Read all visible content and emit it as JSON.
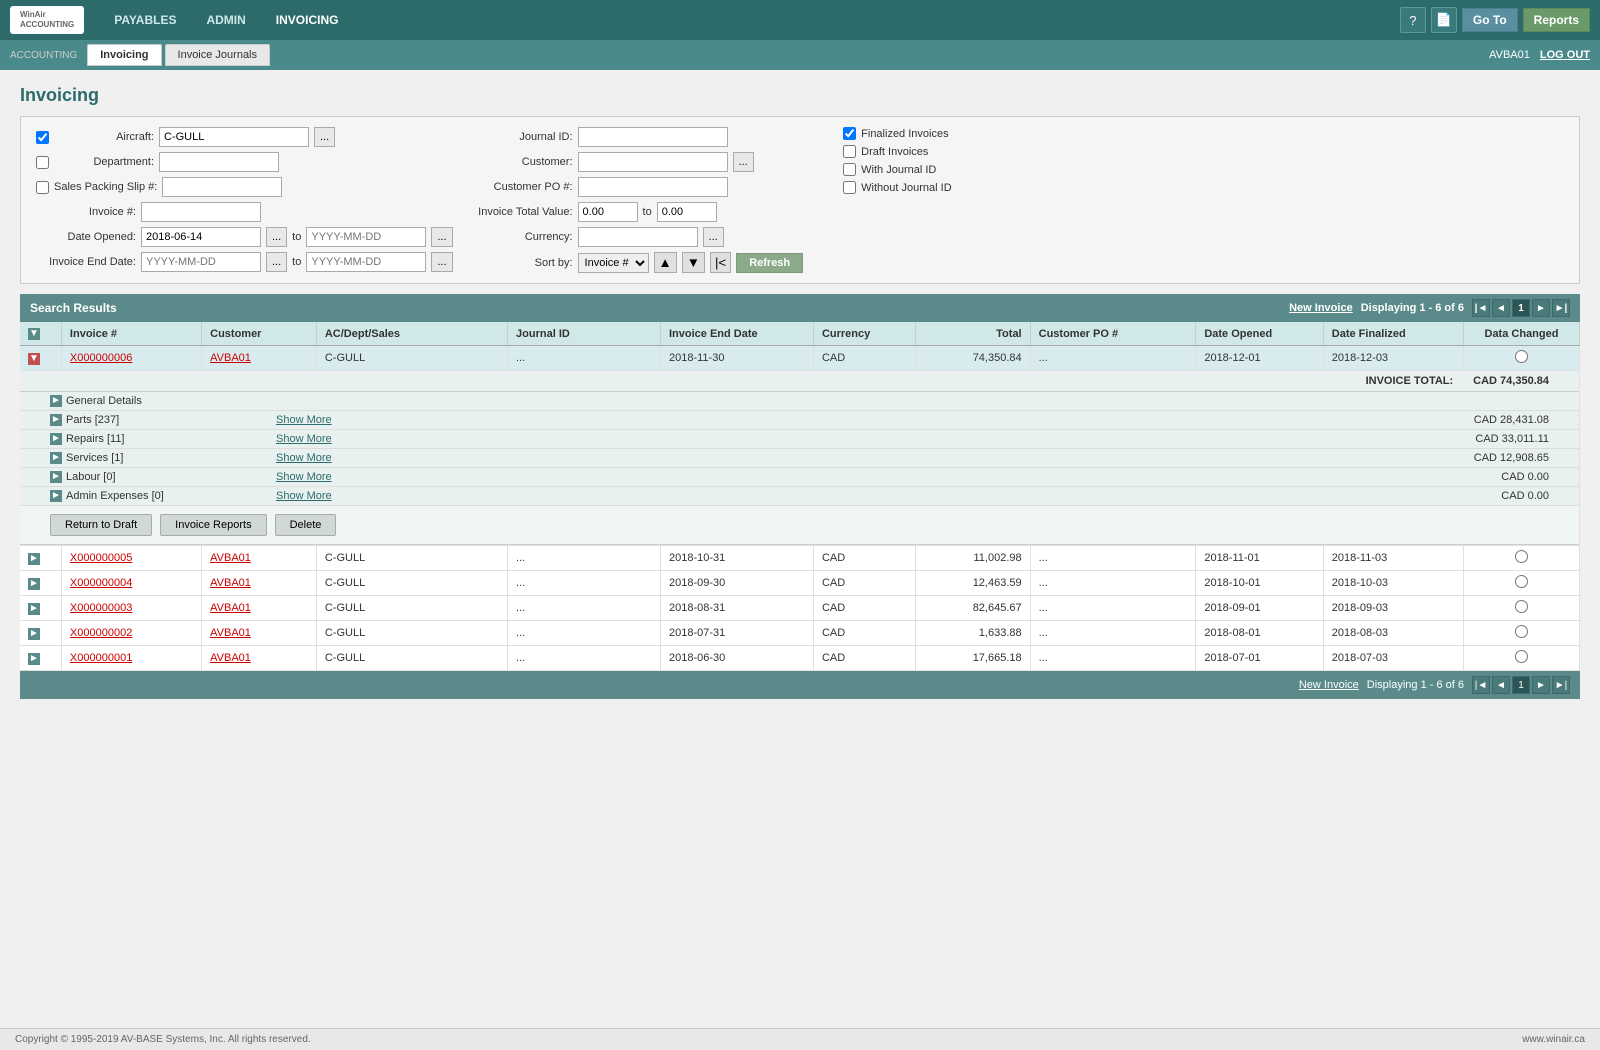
{
  "app": {
    "logo_line1": "WinAir",
    "logo_line2": "ACCOUNTING",
    "nav_items": [
      "PAYABLES",
      "ADMIN",
      "INVOICING"
    ],
    "active_nav": "INVOICING",
    "goto_label": "Go To",
    "reports_label": "Reports",
    "user": "AVBA01",
    "logout": "LOG OUT"
  },
  "second_nav": {
    "accounting_label": "ACCOUNTING",
    "tabs": [
      "Invoicing",
      "Invoice Journals"
    ],
    "active_tab": "Invoicing"
  },
  "page_title": "Invoicing",
  "form": {
    "aircraft_label": "Aircraft:",
    "aircraft_value": "C-GULL",
    "department_label": "Department:",
    "sales_slip_label": "Sales Packing Slip #:",
    "invoice_label": "Invoice #:",
    "date_opened_label": "Date Opened:",
    "date_opened_value": "2018-06-14",
    "to_label": "to",
    "invoice_end_date_label": "Invoice End Date:",
    "journal_id_label": "Journal ID:",
    "customer_label": "Customer:",
    "customer_po_label": "Customer PO #:",
    "invoice_total_label": "Invoice Total Value:",
    "invoice_total_from": "0.00",
    "invoice_total_to": "0.00",
    "currency_label": "Currency:",
    "finalized_label": "Finalized Invoices",
    "draft_label": "Draft Invoices",
    "with_journal_label": "With Journal ID",
    "without_journal_label": "Without Journal ID",
    "sort_label": "Sort by:",
    "sort_value": "Invoice #",
    "refresh_label": "Refresh"
  },
  "results": {
    "title": "Search Results",
    "new_invoice": "New Invoice",
    "displaying": "Displaying 1 - 6 of 6",
    "current_page": "1",
    "columns": [
      "Invoice #",
      "Customer",
      "AC/Dept/Sales",
      "Journal ID",
      "Invoice End Date",
      "Currency",
      "Total",
      "Customer PO #",
      "Date Opened",
      "Date Finalized",
      "Data Changed"
    ],
    "rows": [
      {
        "invoice": "X000000006",
        "customer": "AVBA01",
        "acdept": "C-GULL",
        "journal": "...",
        "end_date": "2018-11-30",
        "currency": "CAD",
        "total": "74,350.84",
        "customer_po": "...",
        "date_opened": "2018-12-01",
        "date_finalized": "2018-12-03",
        "data_changed": "",
        "expanded": true
      },
      {
        "invoice": "X000000005",
        "customer": "AVBA01",
        "acdept": "C-GULL",
        "journal": "...",
        "end_date": "2018-10-31",
        "currency": "CAD",
        "total": "11,002.98",
        "customer_po": "...",
        "date_opened": "2018-11-01",
        "date_finalized": "2018-11-03",
        "data_changed": "",
        "expanded": false
      },
      {
        "invoice": "X000000004",
        "customer": "AVBA01",
        "acdept": "C-GULL",
        "journal": "...",
        "end_date": "2018-09-30",
        "currency": "CAD",
        "total": "12,463.59",
        "customer_po": "...",
        "date_opened": "2018-10-01",
        "date_finalized": "2018-10-03",
        "data_changed": "",
        "expanded": false
      },
      {
        "invoice": "X000000003",
        "customer": "AVBA01",
        "acdept": "C-GULL",
        "journal": "...",
        "end_date": "2018-08-31",
        "currency": "CAD",
        "total": "82,645.67",
        "customer_po": "...",
        "date_opened": "2018-09-01",
        "date_finalized": "2018-09-03",
        "data_changed": "",
        "expanded": false
      },
      {
        "invoice": "X000000002",
        "customer": "AVBA01",
        "acdept": "C-GULL",
        "journal": "...",
        "end_date": "2018-07-31",
        "currency": "CAD",
        "total": "1,633.88",
        "customer_po": "...",
        "date_opened": "2018-08-01",
        "date_finalized": "2018-08-03",
        "data_changed": "",
        "expanded": false
      },
      {
        "invoice": "X000000001",
        "customer": "AVBA01",
        "acdept": "C-GULL",
        "journal": "...",
        "end_date": "2018-06-30",
        "currency": "CAD",
        "total": "17,665.18",
        "customer_po": "...",
        "date_opened": "2018-07-01",
        "date_finalized": "2018-07-03",
        "data_changed": "",
        "expanded": false
      }
    ],
    "expanded_details": {
      "invoice_total_label": "INVOICE TOTAL:",
      "invoice_total_value": "CAD 74,350.84",
      "sections": [
        {
          "label": "General Details",
          "count": null,
          "show_more": false,
          "amount": null
        },
        {
          "label": "Parts",
          "count": 237,
          "show_more": true,
          "amount": "CAD 28,431.08"
        },
        {
          "label": "Repairs",
          "count": 11,
          "show_more": true,
          "amount": "CAD 33,011.11"
        },
        {
          "label": "Services",
          "count": 1,
          "show_more": true,
          "amount": "CAD 12,908.65"
        },
        {
          "label": "Labour",
          "count": 0,
          "show_more": true,
          "amount": "CAD 0.00"
        },
        {
          "label": "Admin Expenses",
          "count": 0,
          "show_more": true,
          "amount": "CAD 0.00"
        }
      ],
      "buttons": [
        "Return to Draft",
        "Invoice Reports",
        "Delete"
      ]
    }
  },
  "footer": {
    "copyright": "Copyright © 1995-2019 AV-BASE Systems, Inc. All rights reserved.",
    "website": "www.winair.ca"
  }
}
